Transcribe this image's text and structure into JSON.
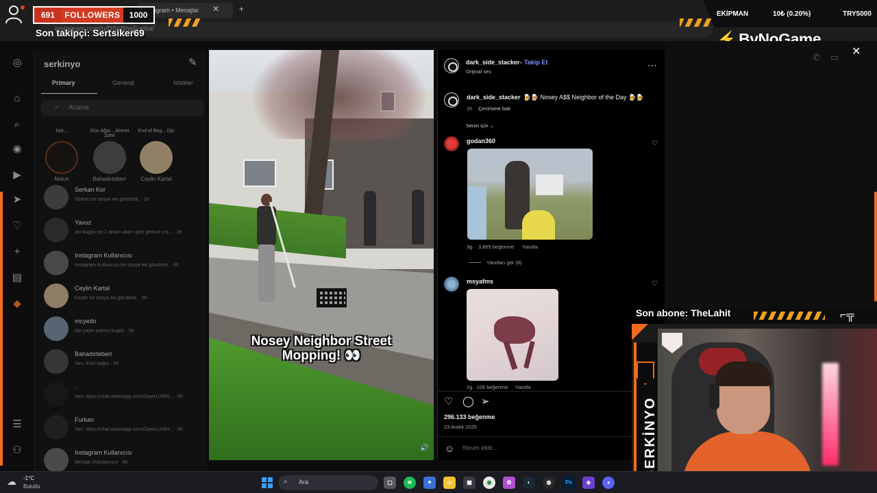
{
  "browser": {
    "tab_title": "Instagram • Mesajlar",
    "url": "instagram.com/p/DSoBhaFupba/"
  },
  "overlay": {
    "follower_count": "691",
    "followers_label": "FOLLOWERS",
    "follower_goal": "1000",
    "last_follower": "Son takipçi: Sertsiker69",
    "equipment_label": "EKİPMAN",
    "donation_progress": "10₺ (0.20%)",
    "donation_goal": "TRY5000",
    "brand": "ByNoGame",
    "last_subscriber": "Son abone: TheLahit",
    "streamer_name": "SERKİNYO",
    "accent_color": "#f26a1b"
  },
  "messages": {
    "username": "serkinyo",
    "tabs": [
      "Primary",
      "General",
      "İstekler"
    ],
    "search_placeholder": "Arama",
    "notes": [
      {
        "bubble": "Not...",
        "name": "Notun"
      },
      {
        "bubble": "Gün Ağar... Ahmet Zahit",
        "name": "Bahadırteberr"
      },
      {
        "bubble": "End of Beg... Djo",
        "name": "Ceylin Kartal"
      }
    ],
    "items": [
      {
        "name": "Serkan Kor",
        "preview": "Serkan bir dosya eki gönderdi. · 2h"
      },
      {
        "name": "Yavuz",
        "preview": "abi bugün rdr 2 alcam abim işten gelince inş... · 2h"
      },
      {
        "name": "Instagram Kullanıcısı",
        "preview": "Instagram Kullanıcısı bir dosya eki gönderdi. · 4h"
      },
      {
        "name": "Ceylin Kartal",
        "preview": "Ceylin bir dosya eki gönderdi. · 5h"
      },
      {
        "name": "mcyedo",
        "preview": "Abi yayın yokmu bugün · 6h"
      },
      {
        "name": "Bahadırteberr",
        "preview": "Sen: Evet doğru · 8h"
      },
      {
        "name": ".",
        "preview": "Sen: https://chat.whatsapp.com/Gqwx1UWH... · 8h"
      },
      {
        "name": "Furkan",
        "preview": "Sen: https://chat.whatsapp.com/Gqwx1UWH... · 8h"
      },
      {
        "name": "Instagram Kullanıcısı",
        "preview": "Mesaja Ulaşılamıyor · 8h"
      }
    ]
  },
  "video": {
    "caption_line1": "Nosey Neighbor Street",
    "caption_line2": "Mopping! 👀"
  },
  "post": {
    "author": "dark_side_stacker",
    "follow_label": "Takip Et",
    "audio": "Orijinal ses",
    "caption_text": "🍺🍺 Nosey A$$ Neighbor of the Day 🍺🍺",
    "caption_time": "1h",
    "see_translation": "Çevirisine bak",
    "sort_label": "Senin için",
    "comments": [
      {
        "user": "godan360",
        "time": "3g",
        "likes": "3.865 beğenme",
        "reply": "Yanıtla",
        "view_replies": "Yanıtları gör (8)"
      },
      {
        "user": "msyafms",
        "time": "2g",
        "likes": "106 beğenme",
        "reply": "Yanıtla"
      }
    ],
    "total_likes": "296.133 beğenme",
    "date": "23 Aralık 2025",
    "comment_placeholder": "Yorum ekle..."
  },
  "taskbar": {
    "temperature": "-1°C",
    "condition": "Bulutlu",
    "search_label": "Ara"
  }
}
